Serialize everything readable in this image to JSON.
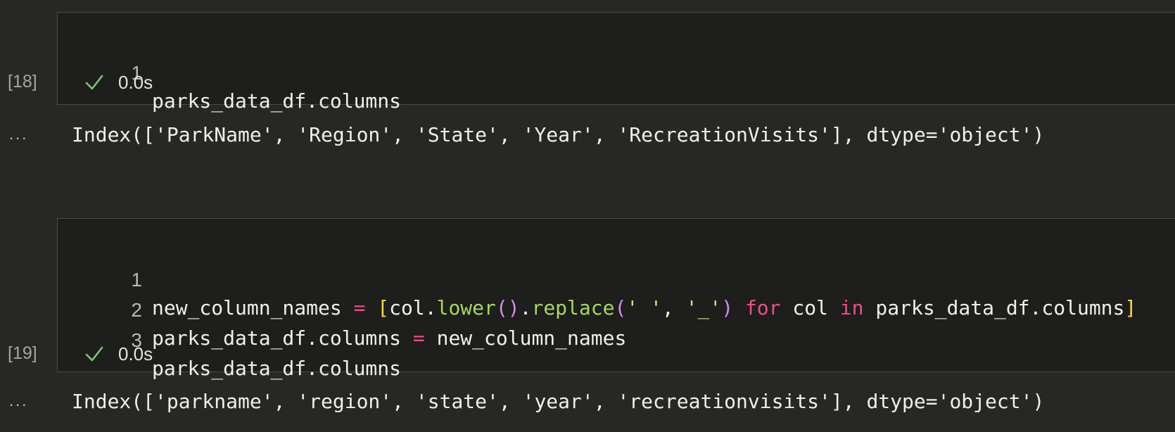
{
  "cells": [
    {
      "execution_count": "[18]",
      "status_time": "0.0s",
      "lines": [
        {
          "number": "1",
          "tokens": [
            {
              "t": "parks_data_df.columns",
              "k": "var"
            }
          ]
        }
      ],
      "output": "Index(['ParkName', 'Region', 'State', 'Year', 'RecreationVisits'], dtype='object')"
    },
    {
      "execution_count": "[19]",
      "status_time": "0.0s",
      "lines": [
        {
          "number": "1",
          "tokens": [
            {
              "t": "new_column_names ",
              "k": "var"
            },
            {
              "t": "=",
              "k": "op"
            },
            {
              "t": " ",
              "k": "var"
            },
            {
              "t": "[",
              "k": "br1"
            },
            {
              "t": "col.",
              "k": "var"
            },
            {
              "t": "lower",
              "k": "fn"
            },
            {
              "t": "()",
              "k": "br2"
            },
            {
              "t": ".",
              "k": "var"
            },
            {
              "t": "replace",
              "k": "fn"
            },
            {
              "t": "(",
              "k": "br2"
            },
            {
              "t": "' '",
              "k": "str"
            },
            {
              "t": ", ",
              "k": "var"
            },
            {
              "t": "'_'",
              "k": "str"
            },
            {
              "t": ")",
              "k": "br2"
            },
            {
              "t": " ",
              "k": "var"
            },
            {
              "t": "for",
              "k": "kw"
            },
            {
              "t": " col ",
              "k": "var"
            },
            {
              "t": "in",
              "k": "kw"
            },
            {
              "t": " parks_data_df.columns",
              "k": "var"
            },
            {
              "t": "]",
              "k": "br1"
            }
          ]
        },
        {
          "number": "2",
          "tokens": [
            {
              "t": "parks_data_df.columns ",
              "k": "var"
            },
            {
              "t": "=",
              "k": "op"
            },
            {
              "t": " new_column_names",
              "k": "var"
            }
          ]
        },
        {
          "number": "3",
          "tokens": [
            {
              "t": "parks_data_df.columns",
              "k": "var"
            }
          ]
        }
      ],
      "output": "Index(['parkname', 'region', 'state', 'year', 'recreationvisits'], dtype='object')"
    }
  ],
  "more_icon": "...",
  "icons": {
    "status": "check-icon",
    "output_menu": "more-icon"
  },
  "colors": {
    "background": "#272824",
    "cell": "#1e1e1c",
    "keyword": "#ec4f86",
    "function": "#a6d95b",
    "bracket_outer": "#ffd740",
    "bracket_inner": "#d58cf0",
    "string": "#ecd67e",
    "success": "#7fc27a"
  }
}
